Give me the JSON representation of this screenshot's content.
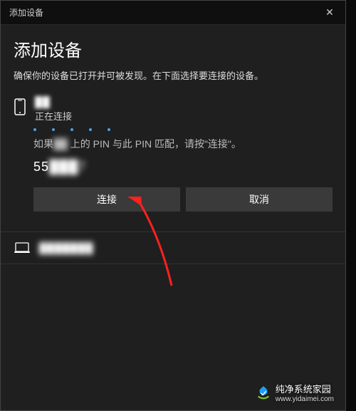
{
  "titlebar": {
    "title": "添加设备",
    "close_label": "✕"
  },
  "heading": "添加设备",
  "subheading": "确保你的设备已打开并可被发现。在下面选择要连接的设备。",
  "device": {
    "name": "██",
    "status": "正在连接",
    "pin_text_prefix": "如果",
    "pin_text_suffix": " 上的 PIN 与此 PIN 匹配，请按\"连接\"。",
    "pin_value_visible": "55",
    "pin_value_hidden": "███7"
  },
  "buttons": {
    "connect": "连接",
    "cancel": "取消"
  },
  "other_device": {
    "name": "███████"
  },
  "watermark": {
    "text": "纯净系统家园",
    "url": "www.yidaimei.com"
  }
}
